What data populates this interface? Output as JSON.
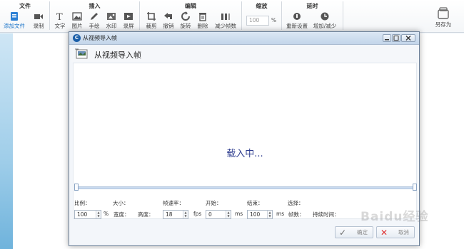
{
  "ribbon": {
    "groups": {
      "file": "文件",
      "insert": "插入",
      "edit": "编辑",
      "zoom": "缩放",
      "delay": "延时"
    },
    "tools": {
      "add_file": "添加文件",
      "record": "录制",
      "text": "文字",
      "image": "图片",
      "draw": "手绘",
      "watermark": "水印",
      "screenshot": "录屏",
      "crop": "裁剪",
      "undo": "撤销",
      "rotate": "旋转",
      "delete": "删除",
      "reduce_frames": "减少帧数",
      "reset": "重新设置",
      "add_reduce": "增加/减少",
      "save_as": "另存为"
    },
    "zoom_value": "100",
    "zoom_unit": "%"
  },
  "dialog": {
    "title": "从视频导入帧",
    "title_icon_letter": "C",
    "header": "从视频导入帧",
    "loading": "载入中...",
    "labels": {
      "ratio": "比例：",
      "size": "大小：",
      "fps_label": "帧速率：",
      "start": "开始：",
      "end": "结束：",
      "selection": "选择："
    },
    "controls": {
      "ratio_value": "100",
      "ratio_unit": "%",
      "width": "宽度：",
      "height": "高度：",
      "fps_value": "18",
      "fps_unit": "fps",
      "start_value": "0",
      "start_unit": "ms",
      "end_value": "100",
      "end_unit": "ms",
      "frames": "帧数：",
      "duration": "持续时间："
    },
    "ok": "确定",
    "cancel": "取消"
  },
  "watermark_text": "Baidu经验",
  "colors": {
    "accent": "#1a73c8",
    "loading_text": "#2e3d8f",
    "ok_check": "#6a6a6a",
    "cancel_x": "#d33"
  }
}
